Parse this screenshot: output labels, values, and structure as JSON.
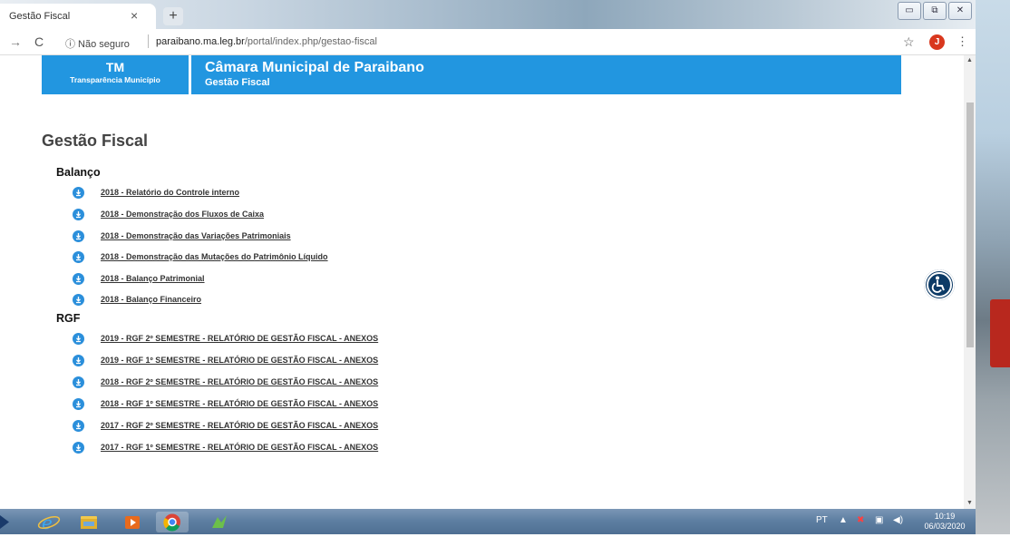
{
  "browser": {
    "tab_title": "Gestão Fiscal",
    "tab_close": "×",
    "new_tab": "+",
    "url_security": "ⓘ Não seguro",
    "url_domain": "paraibano.ma.leg.br",
    "url_path": "/portal/index.php/gestao-fiscal",
    "avatar_letter": "J"
  },
  "header": {
    "left_title": "TM",
    "left_subtitle": "Transparência Município",
    "right_title": "Câmara Municipal de Paraibano",
    "right_subtitle": "Gestão Fiscal",
    "color": "#2296e0"
  },
  "page": {
    "title": "Gestão Fiscal",
    "sections": [
      {
        "name": "Balanço",
        "items": [
          "2018 - Relatório do Controle interno",
          "2018 - Demonstração dos Fluxos de Caixa",
          "2018 - Demonstração das Variações Patrimoniais",
          "2018 - Demonstração das Mutações do Patrimônio Líquido",
          "2018 - Balanço Patrimonial",
          "2018 - Balanço Financeiro"
        ]
      },
      {
        "name": "RGF",
        "items": [
          "2019 - RGF 2º SEMESTRE - RELATÓRIO DE GESTÃO FISCAL - ANEXOS",
          "2019 - RGF 1º SEMESTRE - RELATÓRIO DE GESTÃO FISCAL - ANEXOS",
          "2018 - RGF 2º SEMESTRE - RELATÓRIO DE GESTÃO FISCAL - ANEXOS",
          "2018 - RGF 1º SEMESTRE - RELATÓRIO DE GESTÃO FISCAL - ANEXOS",
          "2017 - RGF 2º SEMESTRE - RELATÓRIO DE GESTÃO FISCAL - ANEXOS",
          "2017 - RGF 1º SEMESTRE - RELATÓRIO DE GESTÃO FISCAL - ANEXOS"
        ]
      }
    ]
  },
  "taskbar": {
    "language": "PT",
    "time": "10:19",
    "date": "06/03/2020"
  }
}
